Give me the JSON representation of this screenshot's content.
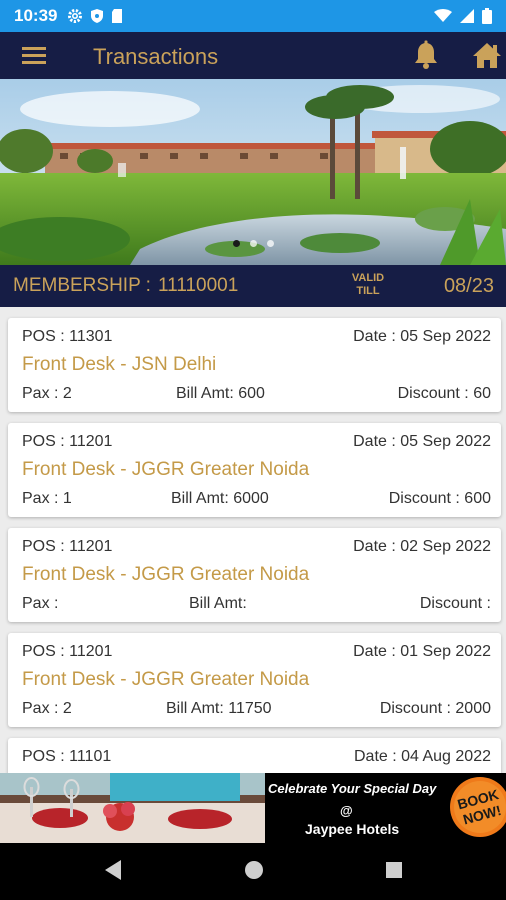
{
  "status_bar": {
    "time": "10:39"
  },
  "header": {
    "title": "Transactions"
  },
  "membership": {
    "label": "MEMBERSHIP :",
    "number": "11110001",
    "valid_label_1": "VALID",
    "valid_label_2": "TILL",
    "valid_date": "08/23"
  },
  "banner": {
    "slide_count": 3,
    "active_slide": 1
  },
  "transactions": [
    {
      "pos_label": "POS : ",
      "pos": "11301",
      "date_label": "Date : ",
      "date": "05 Sep 2022",
      "location": "Front Desk - JSN Delhi",
      "pax_label": "Pax : ",
      "pax": "2",
      "bill_label": "Bill Amt: ",
      "bill": "600",
      "discount_label": "Discount : ",
      "discount": "60"
    },
    {
      "pos_label": "POS : ",
      "pos": "11201",
      "date_label": "Date : ",
      "date": "05 Sep 2022",
      "location": "Front Desk - JGGR Greater Noida",
      "pax_label": "Pax : ",
      "pax": "1",
      "bill_label": "Bill Amt: ",
      "bill": "6000",
      "discount_label": "Discount : ",
      "discount": "600"
    },
    {
      "pos_label": "POS : ",
      "pos": "11201",
      "date_label": "Date : ",
      "date": "02 Sep 2022",
      "location": "Front Desk - JGGR Greater Noida",
      "pax_label": "Pax : ",
      "pax": "",
      "bill_label": "Bill Amt: ",
      "bill": "",
      "discount_label": "Discount : ",
      "discount": ""
    },
    {
      "pos_label": "POS : ",
      "pos": "11201",
      "date_label": "Date : ",
      "date": "01 Sep 2022",
      "location": "Front Desk - JGGR Greater Noida",
      "pax_label": "Pax : ",
      "pax": "2",
      "bill_label": "Bill Amt: ",
      "bill": "11750",
      "discount_label": "Discount : ",
      "discount": "2000"
    },
    {
      "pos_label": "POS : ",
      "pos": "11101",
      "date_label": "Date : ",
      "date": "04 Aug 2022",
      "location": "",
      "pax_label": "",
      "pax": "",
      "bill_label": "",
      "bill": "",
      "discount_label": "",
      "discount": ""
    }
  ],
  "ad": {
    "line1": "Celebrate Your Special Day",
    "line2": "@",
    "line3": "Jaypee Hotels",
    "badge_1": "BOOK",
    "badge_2": "NOW!"
  },
  "colors": {
    "primary": "#161d45",
    "accent": "#caa25a",
    "status_bar": "#1e96e6"
  },
  "icons": {
    "menu": "hamburger-menu-icon",
    "bell": "bell-icon",
    "home": "home-icon",
    "back": "back-triangle-icon",
    "home_nav": "home-circle-icon",
    "recents": "recents-square-icon"
  }
}
